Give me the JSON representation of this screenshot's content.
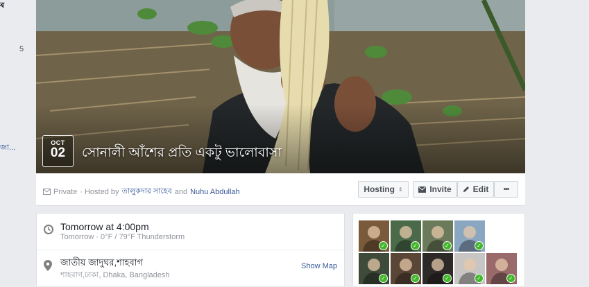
{
  "sidebar_fragments": {
    "top_glyph": "ৰ",
    "count": "5",
    "link_fragment": "জা..."
  },
  "event": {
    "month": "OCT",
    "day": "02",
    "title": "সোনালী আঁশের প্রতি একটু ভালোবাসা"
  },
  "privacy_line": {
    "privacy": "Private",
    "hosted_by": "· Hosted by",
    "host1": "তালুকদার সাহেব",
    "and": "and",
    "host2": "Nuhu Abdullah"
  },
  "actions": {
    "hosting": "Hosting",
    "invite": "Invite",
    "edit": "Edit",
    "more": "•••"
  },
  "details": {
    "time_primary": "Tomorrow at 4:00pm",
    "time_secondary": "Tomorrow · 0°F / 79°F Thunderstorm",
    "place_primary": "জাতীয় জাদুঘর,শাহবাগ",
    "place_secondary": "শাহবাগ,ঢাকা, Dhaka, Bangladesh",
    "show_map": "Show Map"
  },
  "guests": {
    "avatars": [
      {
        "name": "guest-1",
        "color": "#7a5a3a",
        "going": true
      },
      {
        "name": "guest-2",
        "color": "#4a6a4a",
        "going": true
      },
      {
        "name": "guest-3",
        "color": "#6a7a5a",
        "going": true
      },
      {
        "name": "guest-4",
        "color": "#8aa6c0",
        "going": true
      },
      {
        "name": "guest-5",
        "color": "#3e4a3a",
        "going": true
      },
      {
        "name": "guest-6",
        "color": "#5a4636",
        "going": true
      },
      {
        "name": "guest-7",
        "color": "#2e2a28",
        "going": true
      },
      {
        "name": "guest-8",
        "color": "#c8c6c4",
        "going": true
      },
      {
        "name": "guest-9",
        "color": "#9a6a6a",
        "going": true
      }
    ]
  },
  "colors": {
    "link": "#365899",
    "going_badge": "#42b72a",
    "page_bg": "#e9ebee"
  }
}
